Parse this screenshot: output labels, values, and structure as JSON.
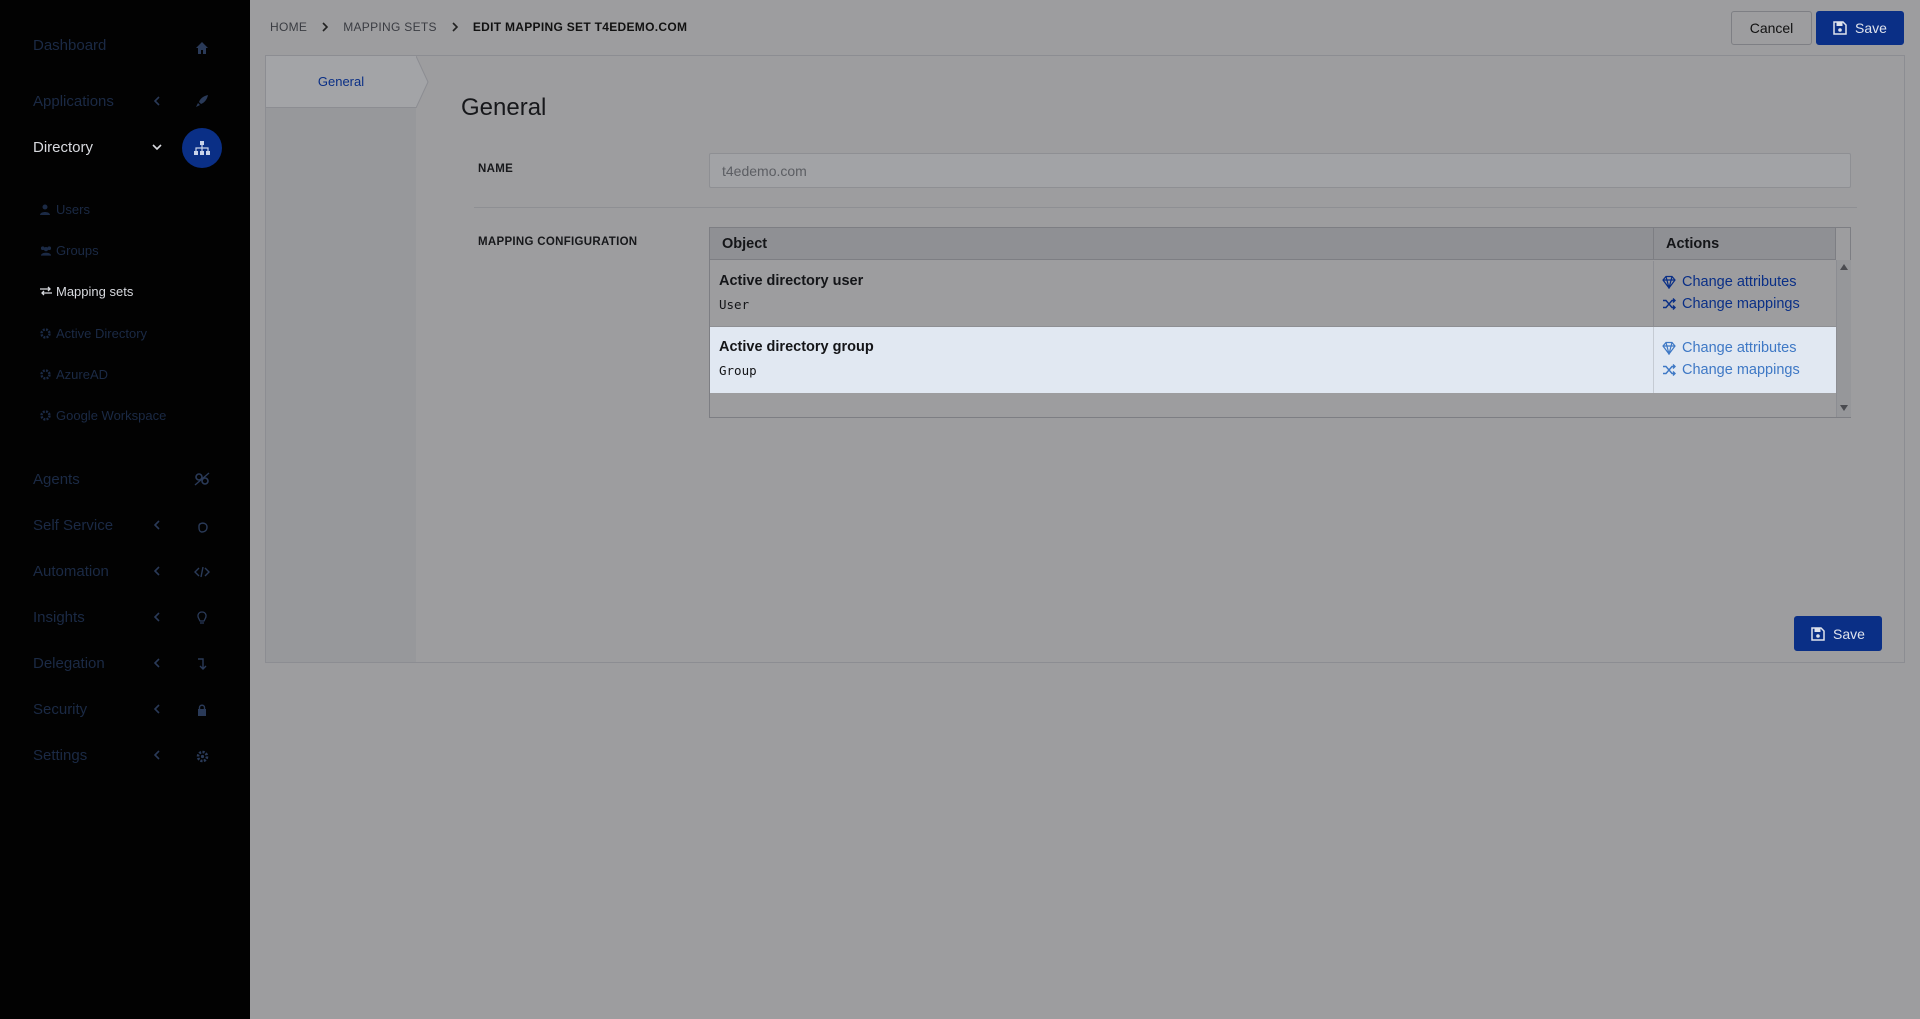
{
  "sidebar": {
    "items": [
      {
        "label": "Dashboard",
        "icon": "home-icon"
      },
      {
        "label": "Applications",
        "icon": "rocket-icon"
      },
      {
        "label": "Directory",
        "icon": "sitemap-icon"
      },
      {
        "label": "Agents",
        "icon": "agents-icon"
      },
      {
        "label": "Self Service",
        "icon": "hand-pointer-icon"
      },
      {
        "label": "Automation",
        "icon": "code-icon"
      },
      {
        "label": "Insights",
        "icon": "lightbulb-icon"
      },
      {
        "label": "Delegation",
        "icon": "level-down-icon"
      },
      {
        "label": "Security",
        "icon": "lock-icon"
      },
      {
        "label": "Settings",
        "icon": "gear-icon"
      }
    ],
    "directory_sub": [
      {
        "label": "Users",
        "icon": "user-icon"
      },
      {
        "label": "Groups",
        "icon": "users-icon"
      },
      {
        "label": "Mapping sets",
        "icon": "exchange-icon"
      },
      {
        "label": "Active Directory",
        "icon": "gear-icon"
      },
      {
        "label": "AzureAD",
        "icon": "gear-icon"
      },
      {
        "label": "Google Workspace",
        "icon": "gear-icon"
      }
    ]
  },
  "breadcrumb": {
    "home": "HOME",
    "mapping_sets": "MAPPING SETS",
    "current": "EDIT MAPPING SET T4EDEMO.COM"
  },
  "toolbar": {
    "cancel_label": "Cancel",
    "save_label": "Save"
  },
  "tabs": {
    "general": "General"
  },
  "form": {
    "section_title": "General",
    "name_label": "NAME",
    "name_value": "t4edemo.com",
    "mapping_label": "MAPPING CONFIGURATION"
  },
  "table": {
    "columns": [
      "Object",
      "Actions"
    ],
    "rows": [
      {
        "title": "Active directory user",
        "type": "User",
        "actions": [
          "Change attributes",
          "Change mappings"
        ]
      },
      {
        "title": "Active directory group",
        "type": "Group",
        "actions": [
          "Change attributes",
          "Change mappings"
        ]
      }
    ]
  },
  "footer": {
    "save_label": "Save"
  },
  "colors": {
    "accent": "#0a2f86",
    "sidebar_bg": "#020202",
    "overlay_bg": "#9d9d9f",
    "selected_row": "#e1e8f2",
    "link": "#3e78c5"
  }
}
